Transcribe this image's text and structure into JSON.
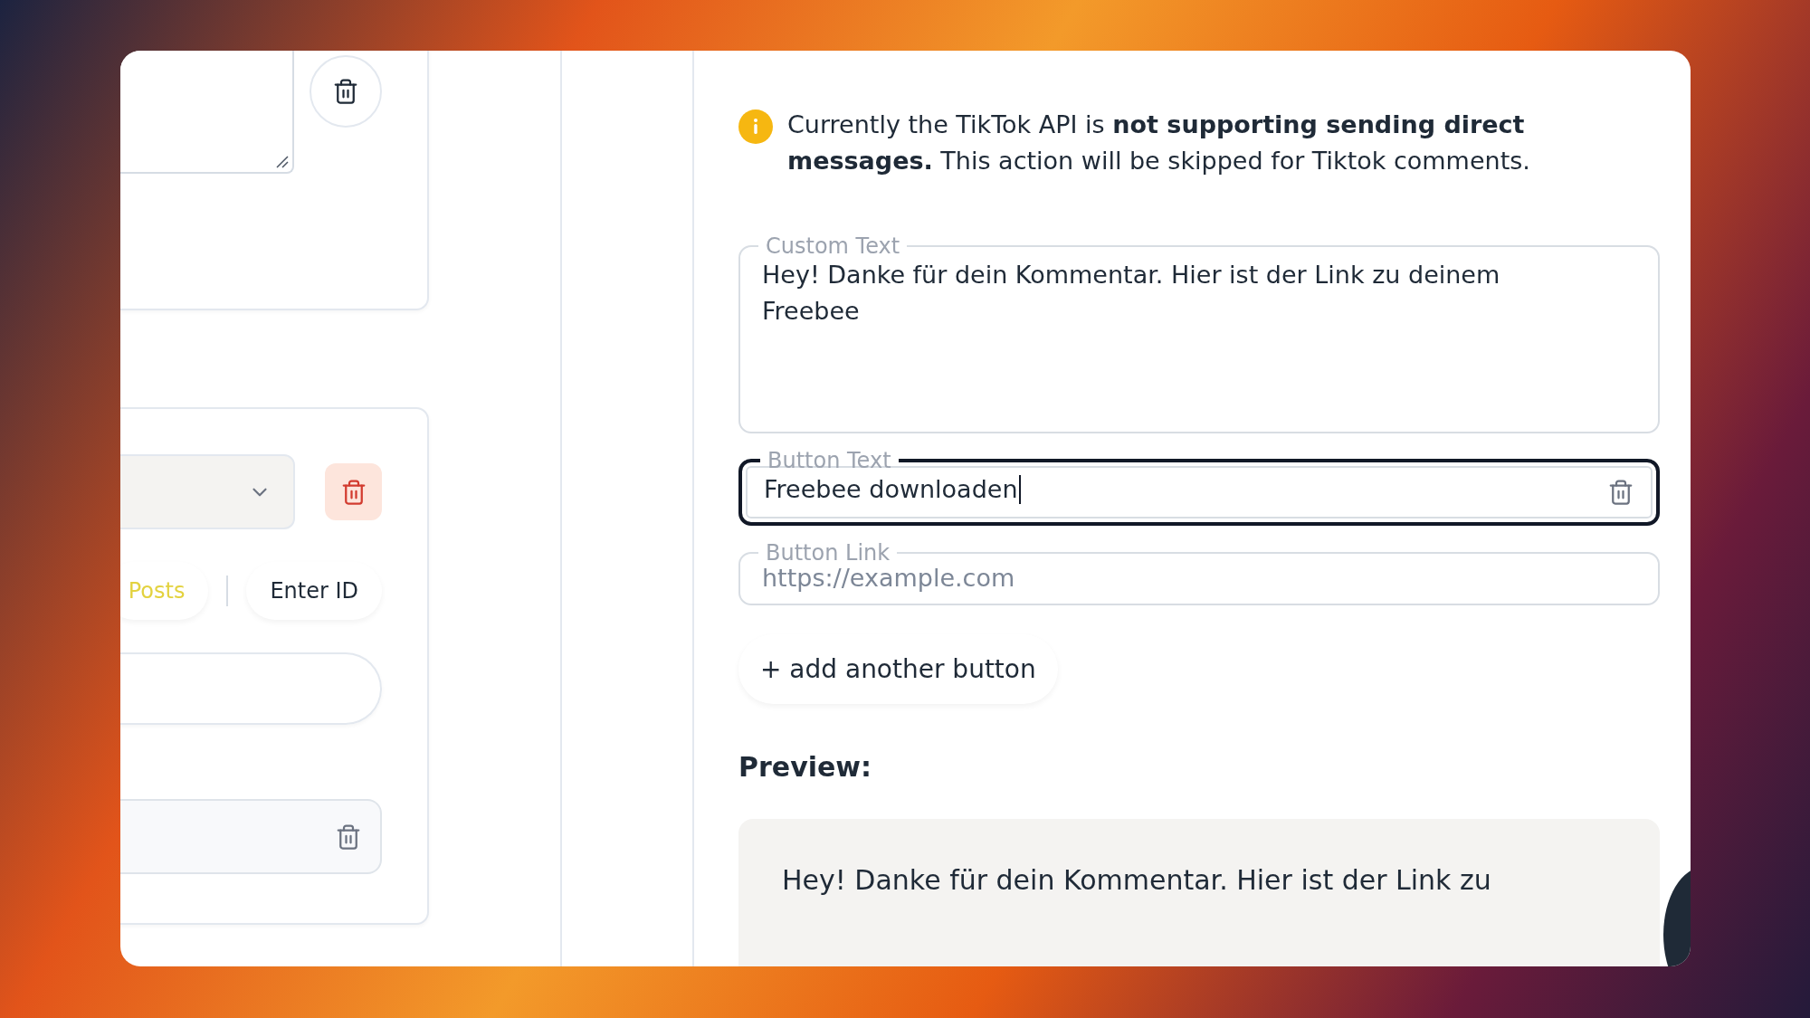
{
  "left_panel": {
    "tabs": [
      {
        "label": "Posts",
        "selected": true
      },
      {
        "label": "Enter ID",
        "selected": false
      }
    ]
  },
  "notice": {
    "text": "Currently the TikTok API is **not supporting sending direct messages.** This action will be skipped for Tiktok comments."
  },
  "fields": [
    {
      "label": "Custom Text",
      "kind": "textarea",
      "value": "Hey! Danke für dein Kommentar. Hier ist der Link zu deinem Freebee",
      "focused": false
    },
    {
      "label": "Button Text",
      "kind": "input",
      "value": "Freebee downloaden",
      "focused": true,
      "deletable": true
    },
    {
      "label": "Button Link",
      "kind": "input",
      "placeholder": "https://example.com",
      "focused": false,
      "deletable": false
    }
  ],
  "add_button": "+ add another button",
  "preview": {
    "title": "Preview:",
    "text": "Hey! Danke für dein Kommentar. Hier ist der Link zu"
  }
}
